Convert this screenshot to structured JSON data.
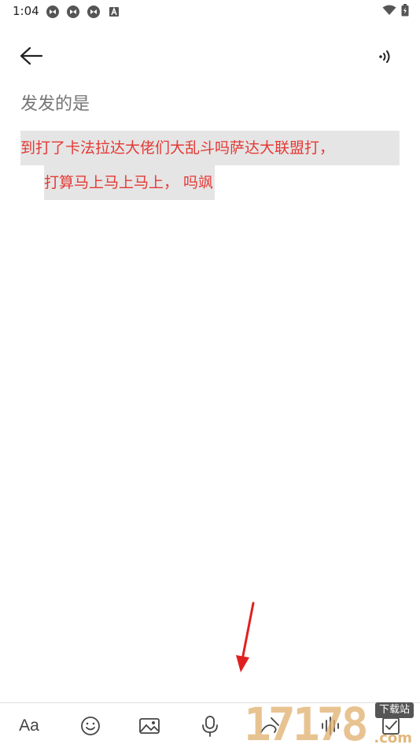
{
  "status_bar": {
    "time": "1:04",
    "left_icons": [
      "app-notification-icon",
      "app-notification-icon",
      "app-notification-icon",
      "a-badge-icon"
    ],
    "right_icons": [
      "wifi-icon",
      "battery-icon"
    ]
  },
  "toolbar": {
    "back_icon": "back-arrow-icon",
    "read_aloud_icon": "read-aloud-icon"
  },
  "note": {
    "title": "发发的是",
    "body_lines": [
      "到打了卡法拉达大佬们大乱斗吗萨达大联盟打，",
      "打算马上马上马上， 吗飒"
    ],
    "body_color": "#e53935",
    "highlight_color": "#e5e5e5"
  },
  "bottom_toolbar": {
    "text_format_label": "Aa",
    "tools": [
      "text-format",
      "emoji-icon",
      "image-icon",
      "microphone-icon",
      "handwriting-icon",
      "audio-wave-icon",
      "checkbox-icon"
    ]
  },
  "annotation": {
    "arrow_color": "#e02020"
  },
  "watermark": {
    "digits": "17178",
    "badge": "下载站",
    "domain": ".com"
  }
}
